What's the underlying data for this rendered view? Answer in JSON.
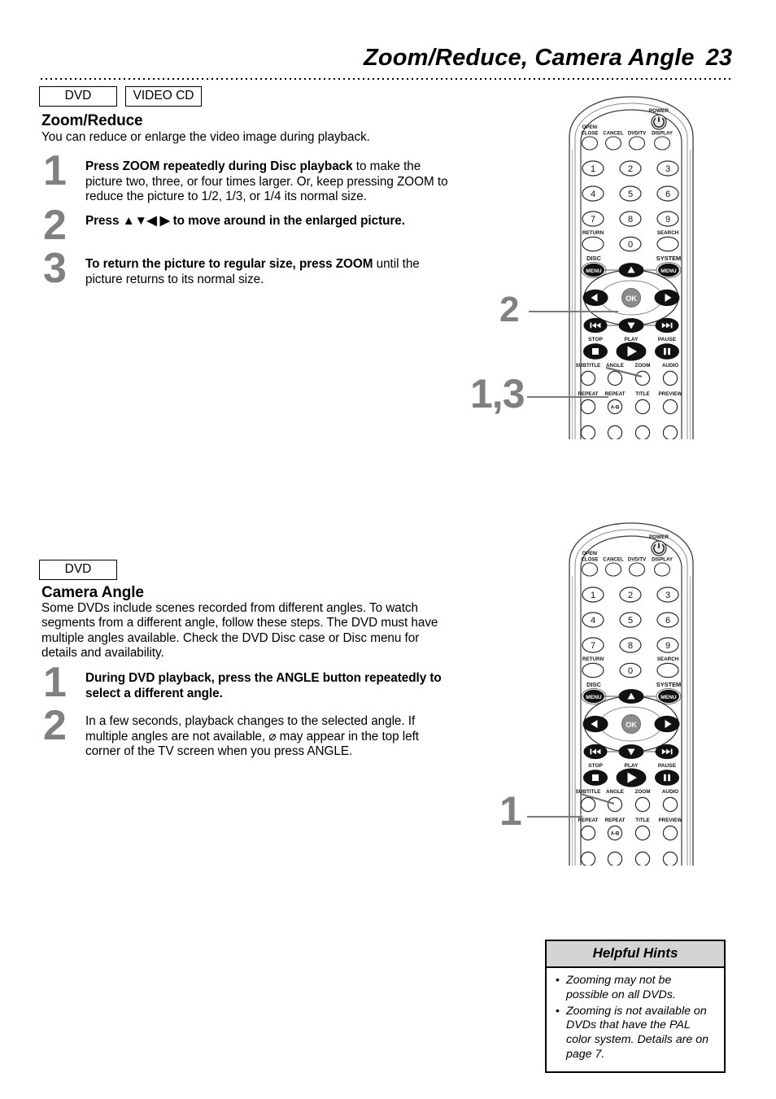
{
  "header": {
    "title": "Zoom/Reduce, Camera Angle",
    "page_number": "23"
  },
  "sections": [
    {
      "id": "zoom-reduce",
      "badges": [
        "DVD",
        "VIDEO CD"
      ],
      "heading": "Zoom/Reduce",
      "intro": "You can reduce or enlarge the video image during playback.",
      "steps": [
        {
          "number": "1",
          "bold_lead": "Press ZOOM repeatedly during Disc playback",
          "rest": " to make the picture two, three, or four times larger. Or, keep pressing ZOOM to reduce the picture to 1/2, 1/3, or 1/4 its normal size."
        },
        {
          "number": "2",
          "bold_lead": "Press ▲▼◀ ▶ to move around in the enlarged picture.",
          "rest": ""
        },
        {
          "number": "3",
          "bold_lead": "To return the picture to regular size, press ZOOM",
          "rest": " until the picture returns to its normal size."
        }
      ]
    },
    {
      "id": "camera-angle",
      "badges": [
        "DVD"
      ],
      "heading": "Camera Angle",
      "intro": "Some DVDs include scenes recorded from different angles. To watch segments from a different angle, follow these steps. The DVD must have multiple angles available. Check the DVD Disc case or Disc menu for details and availability.",
      "steps": [
        {
          "number": "1",
          "bold_lead": "During DVD playback, press the ANGLE button repeatedly to select a different angle.",
          "rest": ""
        },
        {
          "number": "2",
          "bold_lead": "",
          "rest": "In a few seconds, playback changes to the selected angle. If multiple angles are not available, ⌀ may appear in the top left corner of the TV screen when you press ANGLE."
        }
      ]
    }
  ],
  "callouts": {
    "remote_one_upper": "2",
    "remote_one_lower": "1,3",
    "remote_two": "1"
  },
  "hints": {
    "title": "Helpful Hints",
    "items": [
      "Zooming may not be possible on all DVDs.",
      "Zooming is not available on DVDs that have the PAL color system. Details are on page 7."
    ]
  },
  "remote": {
    "power_label": "POWER",
    "top_row": [
      "OPEN/\nCLOSE",
      "CANCEL",
      "DVD/TV",
      "DISPLAY"
    ],
    "numpad": [
      "1",
      "2",
      "3",
      "4",
      "5",
      "6",
      "7",
      "8",
      "9",
      "0"
    ],
    "return_label": "RETURN",
    "search_label": "SEARCH",
    "disc_label": "DISC",
    "system_label": "SYSTEM",
    "menu_label": "MENU",
    "ok_label": "OK",
    "stop_label": "STOP",
    "play_label": "PLAY",
    "pause_label": "PAUSE",
    "function_row": [
      "SUBTITLE",
      "ANGLE",
      "ZOOM",
      "AUDIO"
    ],
    "bottom_row": [
      "REPEAT",
      "REPEAT",
      "TITLE",
      "PREVIEW"
    ],
    "repeat_ab_label": "A-B"
  },
  "colors": {
    "step_number": "#808080",
    "callout": "#808080",
    "hints_header_bg": "#d4d4d4",
    "button_dark": "#1a1a1a",
    "ok_gray": "#8c8c8c",
    "text": "#000000"
  }
}
